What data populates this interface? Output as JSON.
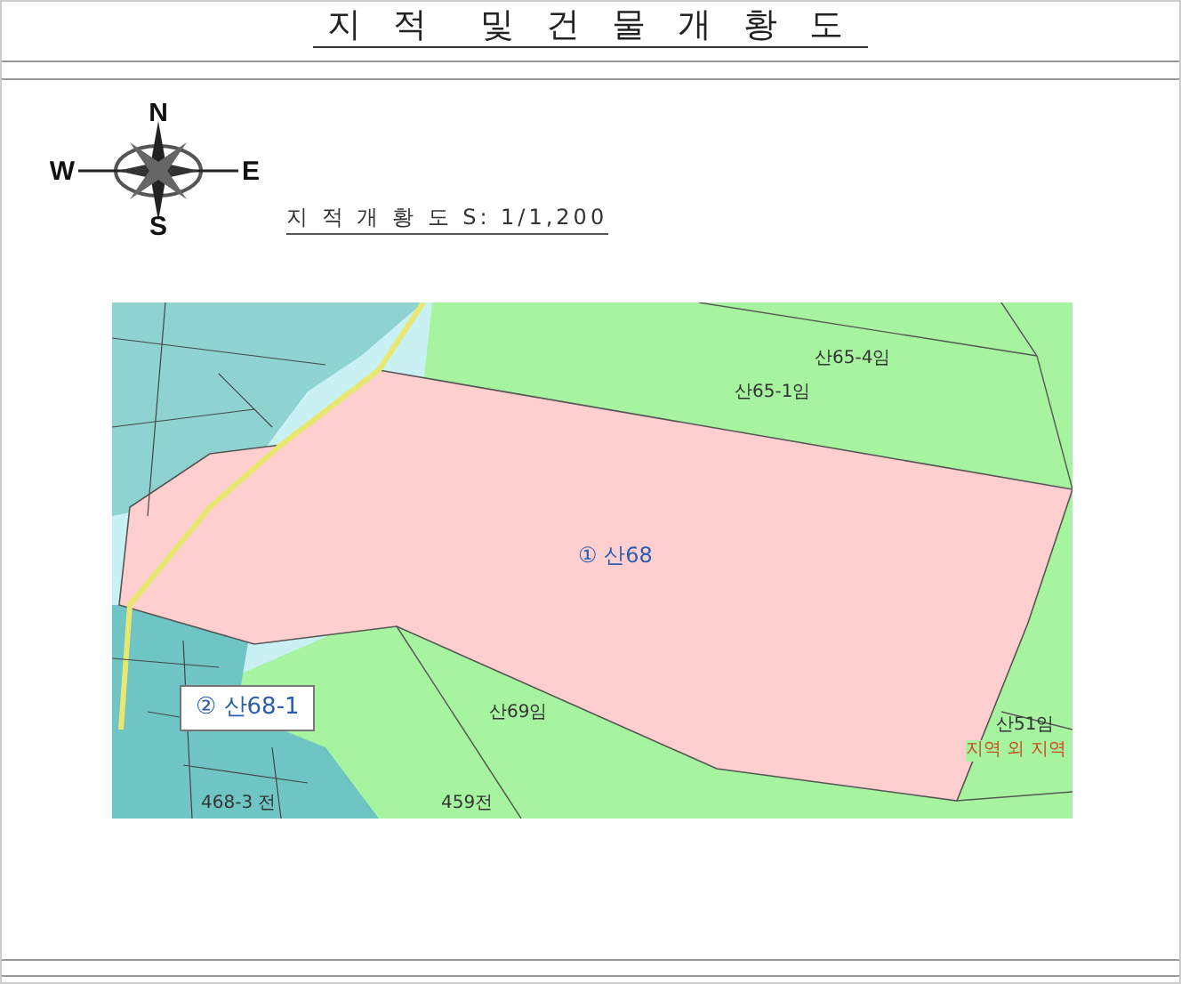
{
  "title": "지 적  및 건 물 개 황 도",
  "compass_labels": [
    "N",
    "E",
    "S",
    "W"
  ],
  "scale_caption": "지 적 개 황 도 S: 1/1,200",
  "map": {
    "labels": [
      {
        "text": "① 산68",
        "kind": "main"
      },
      {
        "text": "② 산68-1",
        "kind": "boxed"
      },
      {
        "text": "산65-4임",
        "kind": "plain"
      },
      {
        "text": "산65-1임",
        "kind": "plain"
      },
      {
        "text": "산69임",
        "kind": "plain"
      },
      {
        "text": "산51임",
        "kind": "plain"
      },
      {
        "text": "468-3 전",
        "kind": "plain"
      },
      {
        "text": "459전",
        "kind": "plain"
      },
      {
        "text": "지역 외 지역",
        "kind": "red"
      }
    ]
  }
}
